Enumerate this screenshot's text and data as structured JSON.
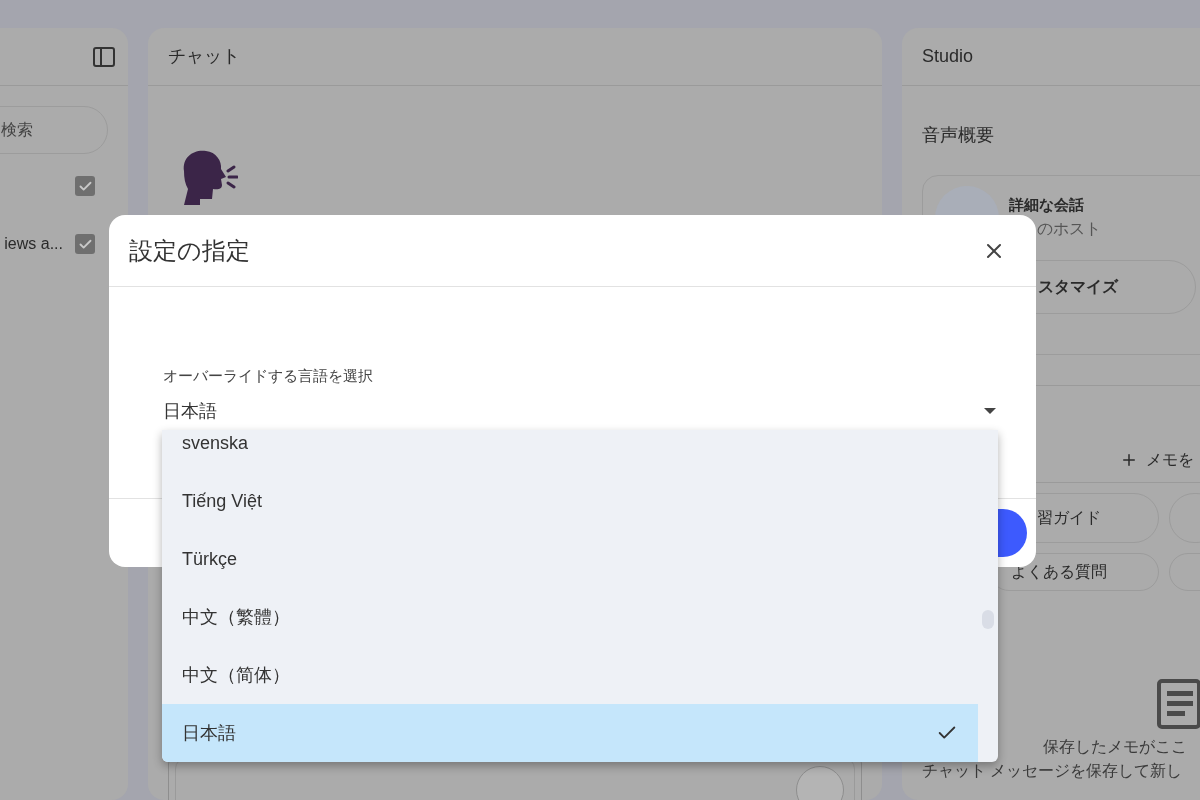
{
  "sidebar": {
    "search": {
      "placeholder": "検索"
    },
    "sources": [
      {
        "checked": true
      },
      {
        "label": "iews a...",
        "checked": true
      }
    ]
  },
  "chat": {
    "title": "チャット"
  },
  "studio": {
    "title": "Studio",
    "audio_overview": {
      "heading": "音声概要",
      "title": "詳細な会話",
      "subtitle": "のホスト",
      "customize_button": "スタマイズ"
    },
    "add_note_button": "メモを",
    "note_chips": [
      "習ガイド",
      "よくある質問"
    ],
    "empty_notes": {
      "title": "保存したメモがここ",
      "text": "チャット メッセージを保存して新し"
    }
  },
  "dialog": {
    "title": "設定の指定",
    "language_select": {
      "label": "オーバーライドする言語を選択",
      "value": "日本語",
      "options": [
        {
          "label": "svenska",
          "selected": false
        },
        {
          "label": "Tiếng Việt",
          "selected": false
        },
        {
          "label": "Türkçe",
          "selected": false
        },
        {
          "label": "中文（繁體）",
          "selected": false
        },
        {
          "label": "中文（简体）",
          "selected": false
        },
        {
          "label": "日本語",
          "selected": true
        }
      ]
    }
  }
}
